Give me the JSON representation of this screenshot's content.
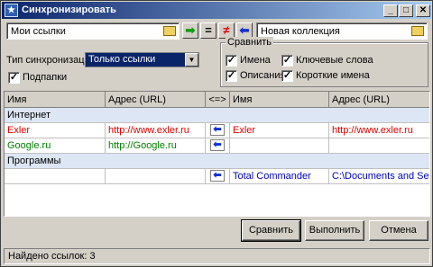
{
  "window": {
    "title": "Синхронизировать",
    "title_icon": "star-icon",
    "controls": {
      "minimize": "_",
      "maximize": "□",
      "close": "✕"
    }
  },
  "left_source": {
    "value": "Мои ссылки"
  },
  "right_source": {
    "value": "Новая коллекция"
  },
  "center_buttons": {
    "copy_right": "➡",
    "equal": "=",
    "not_equal": "≠",
    "copy_left": "⬅"
  },
  "sync": {
    "type_label": "Тип синхронизации",
    "type_value": "Только ссылки",
    "subfolders_label": "Подпапки",
    "subfolders_checked": "✓"
  },
  "compare": {
    "title": "Сравнить",
    "names": "Имена",
    "keywords": "Ключевые слова",
    "descriptions": "Описания",
    "short_names": "Короткие имена",
    "check_mark": "✓"
  },
  "grid": {
    "headers": [
      "Имя",
      "Адрес (URL)",
      "<=>",
      "Имя",
      "Адрес (URL)"
    ],
    "rows": [
      {
        "group": "Интернет"
      },
      {
        "left_name": "Exler",
        "left_url": "http://www.exler.ru",
        "action": "⬅",
        "right_name": "Exler",
        "right_url": "http://www.exler.ru"
      },
      {
        "left_name": "Google.ru",
        "left_url": "http://Google.ru",
        "action": "⬅",
        "right_name": "",
        "right_url": ""
      },
      {
        "group": "Программы"
      },
      {
        "left_name": "",
        "left_url": "",
        "action": "⬅",
        "right_name": "Total Commander",
        "right_url": "C:\\Documents and Settin..."
      }
    ]
  },
  "buttons": {
    "compare": "Сравнить",
    "execute": "Выполнить",
    "cancel": "Отмена"
  },
  "status": {
    "text": "Найдено ссылок: 3"
  }
}
